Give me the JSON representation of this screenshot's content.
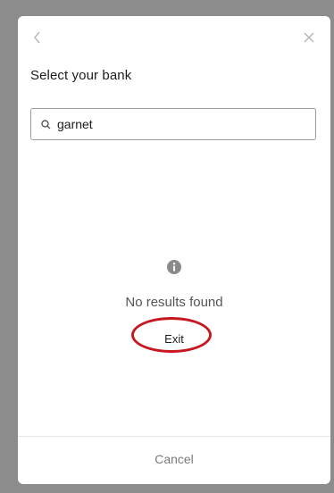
{
  "modal": {
    "title": "Select your bank"
  },
  "search": {
    "value": "garnet"
  },
  "empty_state": {
    "message": "No results found",
    "exit_label": "Exit"
  },
  "footer": {
    "cancel_label": "Cancel"
  },
  "icons": {
    "back": "chevron-left-icon",
    "close": "close-icon",
    "search": "search-icon",
    "info": "info-icon"
  },
  "colors": {
    "highlight": "#c8171e",
    "muted_text": "#7a7a7a"
  }
}
